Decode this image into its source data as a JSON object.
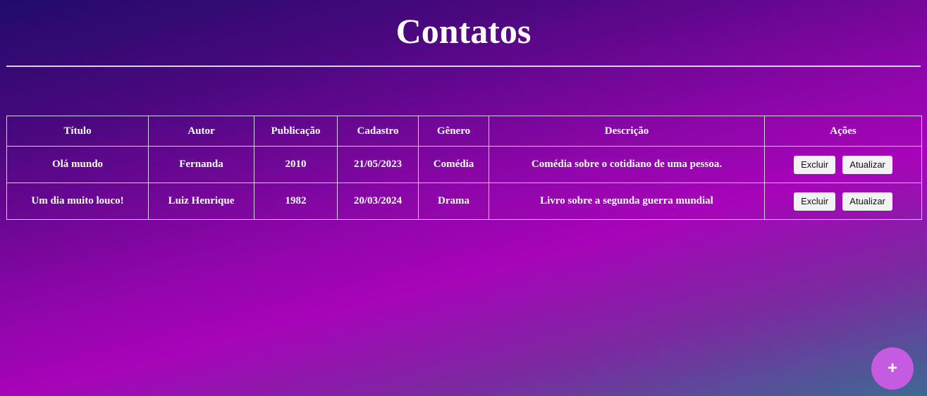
{
  "page": {
    "title": "Contatos"
  },
  "table": {
    "headers": [
      "Título",
      "Autor",
      "Publicação",
      "Cadastro",
      "Gênero",
      "Descrição",
      "Ações"
    ],
    "rows": [
      {
        "titulo": "Olá mundo",
        "autor": "Fernanda",
        "publicacao": "2010",
        "cadastro": "21/05/2023",
        "genero": "Comédia",
        "descricao": "Comédia sobre o cotidiano de uma pessoa.",
        "delete_label": "Excluir",
        "update_label": "Atualizar"
      },
      {
        "titulo": "Um dia muito louco!",
        "autor": "Luiz Henrique",
        "publicacao": "1982",
        "cadastro": "20/03/2024",
        "genero": "Drama",
        "descricao": "Livro sobre a segunda guerra mundial",
        "delete_label": "Excluir",
        "update_label": "Atualizar"
      }
    ]
  },
  "fab": {
    "label": "+",
    "icon": "plus-icon",
    "color": "#c45be0"
  },
  "colors": {
    "background_top": "#210b6b",
    "background_mid": "#a704b9",
    "background_bottom": "#3d6a93"
  }
}
